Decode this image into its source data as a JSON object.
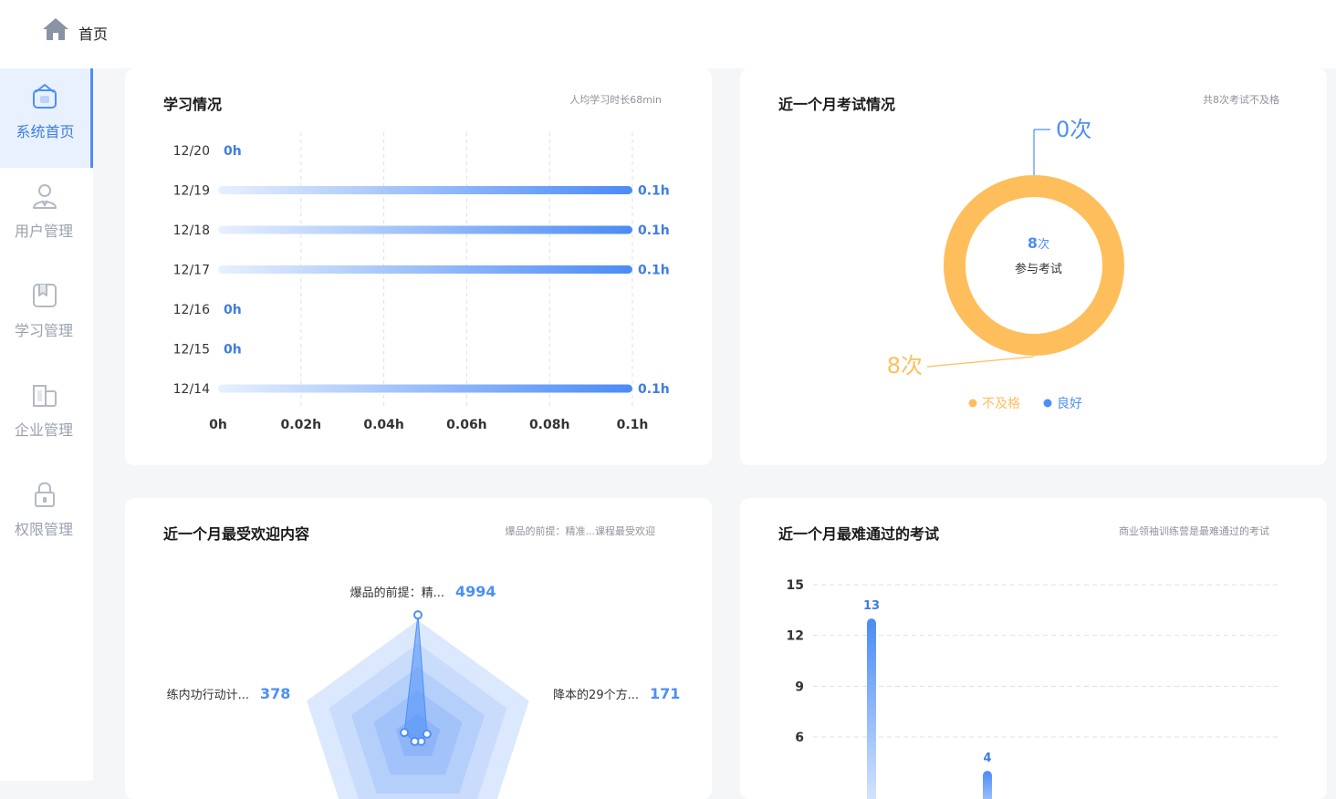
{
  "header": {
    "home_label": "首页"
  },
  "sidebar": {
    "items": [
      {
        "label": "系统首页",
        "icon": "home-square-icon",
        "active": true
      },
      {
        "label": "用户管理",
        "icon": "user-icon",
        "active": false
      },
      {
        "label": "学习管理",
        "icon": "bookmark-icon",
        "active": false
      },
      {
        "label": "企业管理",
        "icon": "building-icon",
        "active": false
      },
      {
        "label": "权限管理",
        "icon": "lock-icon",
        "active": false
      }
    ]
  },
  "study": {
    "title": "学习情况",
    "note": "人均学习时长68min"
  },
  "exam": {
    "title": "近一个月考试情况",
    "note": "共8次考试不及格",
    "center_count": "8",
    "center_unit": "次",
    "center_label": "参与考试",
    "good_callout": "0次",
    "fail_callout": "8次",
    "legend_fail": "不及格",
    "legend_good": "良好"
  },
  "popular": {
    "title": "近一个月最受欢迎内容",
    "note": "爆品的前提：精准...课程最受欢迎"
  },
  "hardest": {
    "title": "近一个月最难通过的考试",
    "note": "商业领袖训练营是最难通过的考试"
  },
  "colors": {
    "accent": "#4d8ff7",
    "orange": "#ffbe5c",
    "label_blue": "#3f7de0"
  },
  "chart_data": [
    {
      "type": "bar",
      "orientation": "horizontal",
      "categories": [
        "12/20",
        "12/19",
        "12/18",
        "12/17",
        "12/16",
        "12/15",
        "12/14"
      ],
      "values": [
        0,
        0.1,
        0.1,
        0.1,
        0,
        0,
        0.1
      ],
      "value_labels": [
        "0h",
        "0.1h",
        "0.1h",
        "0.1h",
        "0h",
        "0h",
        "0.1h"
      ],
      "xticks": [
        "0h",
        "0.02h",
        "0.04h",
        "0.06h",
        "0.08h",
        "0.1h"
      ],
      "xlim": [
        0,
        0.1
      ],
      "grid": "vertical-dashed"
    },
    {
      "type": "pie",
      "style": "donut",
      "series": [
        {
          "name": "不及格",
          "value": 8
        },
        {
          "name": "良好",
          "value": 0
        }
      ],
      "legend": "bottom"
    },
    {
      "type": "radar",
      "indicators": [
        "爆品的前提：精...",
        "降本的29个方...",
        "",
        "",
        "练内功行动计..."
      ],
      "value_labels": [
        "4994",
        "171",
        "",
        "",
        "378"
      ],
      "values": [
        4994,
        171,
        0,
        0,
        378
      ],
      "max": 5000
    },
    {
      "type": "bar",
      "orientation": "vertical",
      "values": [
        13,
        4
      ],
      "value_labels": [
        "13",
        "4"
      ],
      "yticks": [
        "15",
        "12",
        "9",
        "6"
      ],
      "ylim": [
        0,
        15
      ],
      "grid": "horizontal-dashed"
    }
  ]
}
